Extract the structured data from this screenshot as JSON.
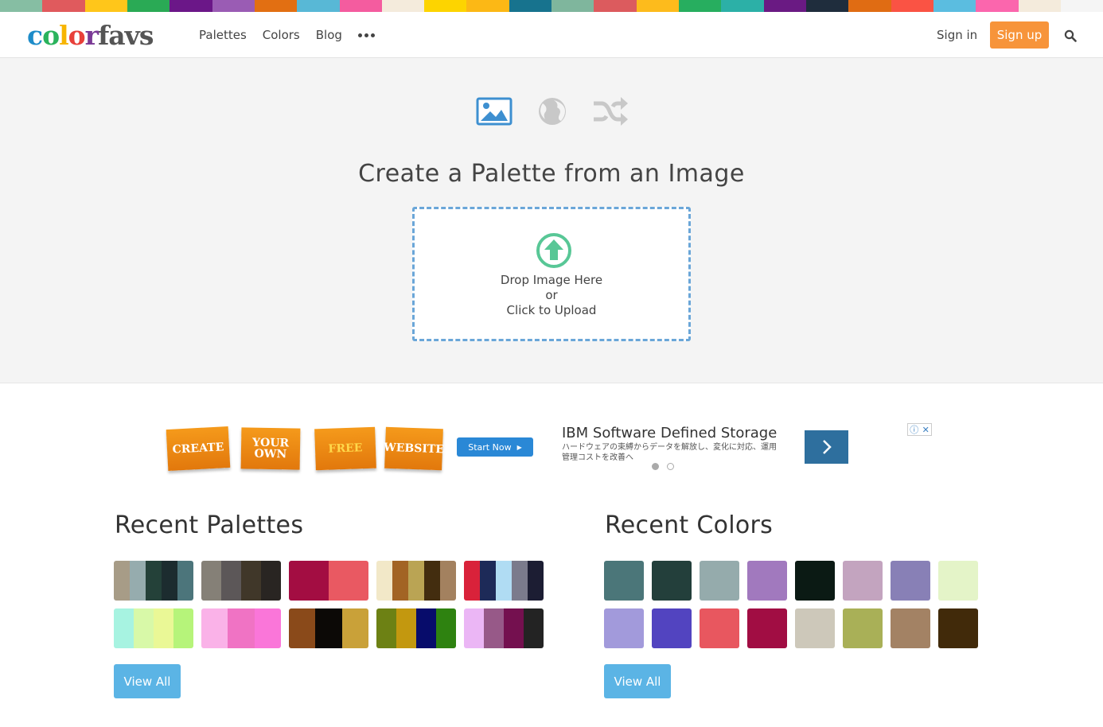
{
  "brand": {
    "letters": [
      "c",
      "o",
      "l",
      "o",
      "r",
      "f",
      "a",
      "v",
      "s"
    ],
    "letter_colors": [
      "#1e8cc9",
      "#2ab35c",
      "#f7b500",
      "#e8403a",
      "#7a3a96",
      "#555555",
      "#555555",
      "#555555",
      "#555555"
    ]
  },
  "top_stripe": [
    "#86bea3",
    "#e05a5d",
    "#ffc61a",
    "#2aaa55",
    "#6b1788",
    "#9a5cb4",
    "#e26f12",
    "#58b8d6",
    "#f45c9f",
    "#f4ebdc",
    "#fdd400",
    "#fcb815",
    "#17738e",
    "#7fb69d",
    "#dc5b5e",
    "#fdbb1c",
    "#27ae5f",
    "#2cb0a7",
    "#6a1a83",
    "#1f2d3d",
    "#e06c13",
    "#fa5344",
    "#5bbde0",
    "#fb66ad",
    "#f4ebdc",
    "#f5f5f5"
  ],
  "nav": {
    "items": [
      "Palettes",
      "Colors",
      "Blog"
    ],
    "more_icon": "ellipsis-icon",
    "sign_in": "Sign in",
    "sign_up": "Sign up",
    "search_icon": "search-icon"
  },
  "hero": {
    "title": "Create a Palette from an Image",
    "modes": [
      "image-icon",
      "globe-icon",
      "shuffle-icon"
    ],
    "dropzone": {
      "line1": "Drop Image Here",
      "line2": "or",
      "line3": "Click to Upload"
    }
  },
  "ad": {
    "tiles": [
      "CREATE",
      "YOUR OWN",
      "FREE",
      "WEBSITE"
    ],
    "start_label": "Start Now",
    "title": "IBM Software Defined Storage",
    "subtitle": "ハードウェアの束縛からデータを解放し、変化に対応、運用管理コストを改善へ"
  },
  "recent_palettes": {
    "title": "Recent Palettes",
    "view_all": "View All",
    "palettes": [
      [
        "#a79c87",
        "#96acae",
        "#244139",
        "#1c2c2f",
        "#4c757b"
      ],
      [
        "#858077",
        "#5c5758",
        "#403729",
        "#292522"
      ],
      [
        "#a30d42",
        "#e95962"
      ],
      [
        "#f2e8c8",
        "#a26424",
        "#baa454",
        "#432d0f",
        "#a3815f"
      ],
      [
        "#d9223a",
        "#1d2a58",
        "#b0dcf3",
        "#7b7b8c",
        "#1c1d33"
      ],
      [
        "#a7f3e1",
        "#d8f9a8",
        "#eaf896",
        "#b6f47a"
      ],
      [
        "#fab2e8",
        "#f073c4",
        "#fa76d9"
      ],
      [
        "#8a4a1a",
        "#0c0906",
        "#c9a139"
      ],
      [
        "#6d8114",
        "#c3980f",
        "#070c6b",
        "#2e8210"
      ],
      [
        "#ebb6f5",
        "#975988",
        "#74104f",
        "#232323"
      ]
    ]
  },
  "recent_colors": {
    "title": "Recent Colors",
    "view_all": "View All",
    "colors": [
      "#4b7679",
      "#233f3b",
      "#95abac",
      "#a179be",
      "#0b1a14",
      "#c3a4bf",
      "#8880b6",
      "#e4f4c8",
      "#a29adb",
      "#5244c0",
      "#e8575f",
      "#a10d43",
      "#cdc8ba",
      "#a9b057",
      "#a38264",
      "#412a0a"
    ]
  }
}
